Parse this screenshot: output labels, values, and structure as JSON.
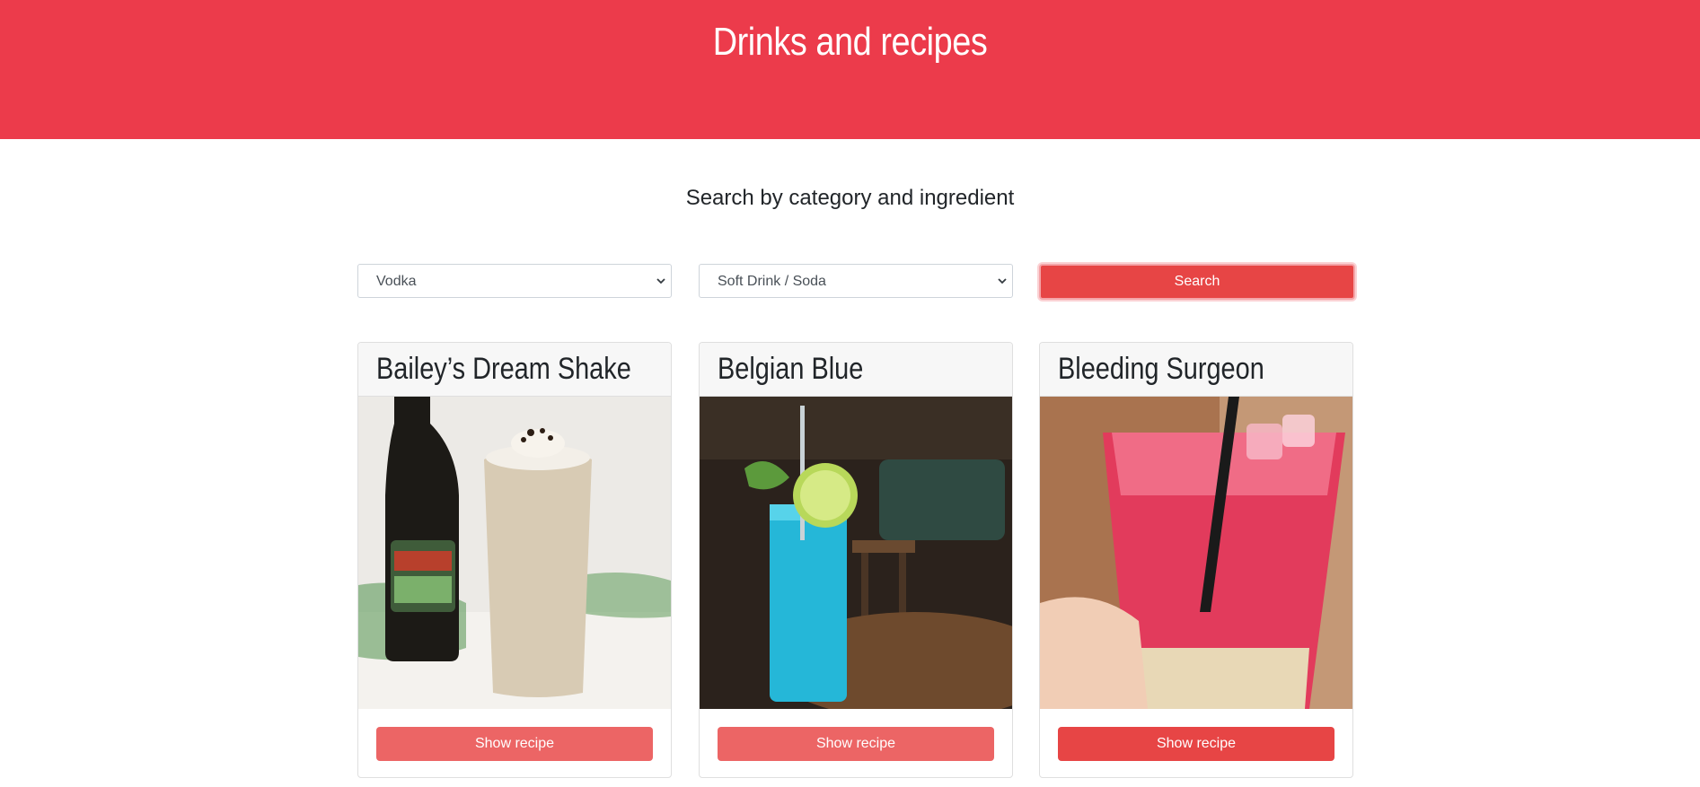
{
  "header": {
    "title": "Drinks and recipes",
    "background_color": "#ec3b4b"
  },
  "search": {
    "subtitle": "Search by category and ingredient",
    "ingredient_select": {
      "selected": "Vodka"
    },
    "category_select": {
      "selected": "Soft Drink / Soda"
    },
    "button_label": "Search",
    "button_color": "#e74545"
  },
  "cards": [
    {
      "title": "Bailey’s Dream Shake",
      "button_label": "Show recipe",
      "button_color": "#ec6565"
    },
    {
      "title": "Belgian Blue",
      "button_label": "Show recipe",
      "button_color": "#ec6565"
    },
    {
      "title": "Bleeding Surgeon",
      "button_label": "Show recipe",
      "button_color": "#e74545"
    }
  ]
}
